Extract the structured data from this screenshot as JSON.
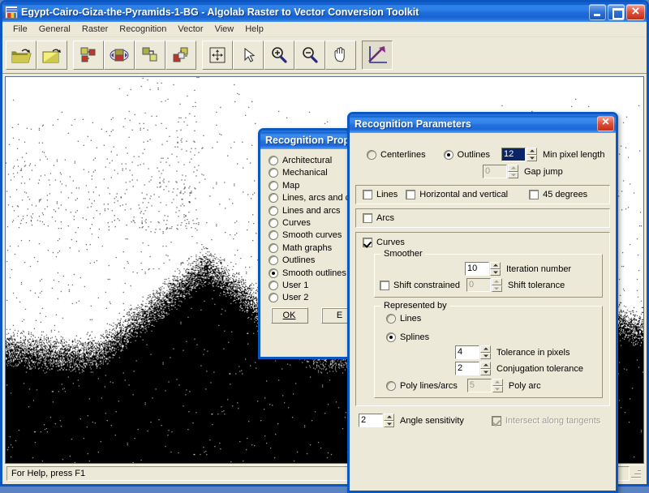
{
  "window": {
    "title": "Egypt-Cairo-Giza-the-Pyramids-1-BG - Algolab Raster to Vector Conversion Toolkit",
    "icon": "app-icon",
    "controls": {
      "minimize": "minimize-button",
      "maximize": "maximize-button",
      "close": "close-button"
    }
  },
  "menu": {
    "items": [
      {
        "label": "File"
      },
      {
        "label": "General"
      },
      {
        "label": "Raster"
      },
      {
        "label": "Recognition"
      },
      {
        "label": "Vector"
      },
      {
        "label": "View"
      },
      {
        "label": "Help"
      }
    ]
  },
  "toolbar": {
    "groups": [
      {
        "buttons": [
          {
            "icon": "open-folder-icon",
            "state": "raised"
          },
          {
            "icon": "open-image-icon",
            "state": "raised"
          }
        ]
      },
      {
        "buttons": [
          {
            "icon": "color-reduce-icon",
            "state": "raised"
          },
          {
            "icon": "invert-colors-icon",
            "state": "raised"
          },
          {
            "icon": "color-swap-icon",
            "state": "raised"
          },
          {
            "icon": "color-layers-icon",
            "state": "raised"
          }
        ]
      },
      {
        "buttons": [
          {
            "icon": "fit-to-window-icon",
            "state": "raised"
          },
          {
            "icon": "select-arrow-icon",
            "state": "raised"
          },
          {
            "icon": "zoom-in-icon",
            "state": "raised"
          },
          {
            "icon": "zoom-out-icon",
            "state": "raised"
          },
          {
            "icon": "pan-hand-icon",
            "state": "raised"
          }
        ]
      },
      {
        "buttons": [
          {
            "icon": "vectorize-icon",
            "state": "pressed"
          }
        ]
      }
    ]
  },
  "canvas": {
    "name": "raster-image-canvas",
    "description": "Dithered black and white raster image of the Giza pyramids"
  },
  "statusbar": {
    "message": "For Help, press F1"
  },
  "properties_dialog": {
    "title": "Recognition Prop",
    "options": [
      {
        "label": "Architectural",
        "selected": false
      },
      {
        "label": "Mechanical",
        "selected": false
      },
      {
        "label": "Map",
        "selected": false
      },
      {
        "label": "Lines, arcs and c",
        "selected": false
      },
      {
        "label": "Lines and arcs",
        "selected": false
      },
      {
        "label": "Curves",
        "selected": false
      },
      {
        "label": "Smooth curves",
        "selected": false
      },
      {
        "label": "Math graphs",
        "selected": false
      },
      {
        "label": "Outlines",
        "selected": false
      },
      {
        "label": "Smooth outlines",
        "selected": true
      },
      {
        "label": "User 1",
        "selected": false
      },
      {
        "label": "User 2",
        "selected": false
      }
    ],
    "buttons": {
      "ok": "OK",
      "edit": "E"
    }
  },
  "parameters_dialog": {
    "title": "Recognition Parameters",
    "mode": {
      "centerlines": {
        "label": "Centerlines",
        "selected": false
      },
      "outlines": {
        "label": "Outlines",
        "selected": true
      }
    },
    "min_pixel_length": {
      "label": "Min pixel length",
      "value": "12",
      "selected": true,
      "disabled": false
    },
    "gap_jump": {
      "label": "Gap jump",
      "value": "0",
      "disabled": true
    },
    "lines_group": [
      {
        "label": "Lines",
        "checked": false,
        "disabled": false
      },
      {
        "label": "Horizontal and vertical",
        "checked": false,
        "disabled": false
      },
      {
        "label": "45 degrees",
        "checked": false,
        "disabled": false
      }
    ],
    "arcs": {
      "label": "Arcs",
      "checked": false,
      "disabled": false
    },
    "curves": {
      "label": "Curves",
      "checked": true,
      "disabled": false
    },
    "smoother": {
      "legend": "Smoother",
      "iteration_number": {
        "label": "Iteration number",
        "value": "10",
        "disabled": false
      },
      "shift_constrained": {
        "label": "Shift constrained",
        "checked": false,
        "disabled": false
      },
      "shift_tolerance": {
        "label": "Shift tolerance",
        "value": "0",
        "disabled": true
      }
    },
    "represented_by": {
      "legend": "Represented by",
      "lines": {
        "label": "Lines",
        "selected": false
      },
      "splines": {
        "label": "Splines",
        "selected": true
      },
      "poly_lines_arcs": {
        "label": "Poly lines/arcs",
        "selected": false
      },
      "tolerance_in_pixels": {
        "label": "Tolerance in pixels",
        "value": "4",
        "disabled": false
      },
      "conjugation_tolerance": {
        "label": "Conjugation tolerance",
        "value": "2",
        "disabled": false
      },
      "poly_arc": {
        "label": "Poly arc",
        "value": "5",
        "disabled": true
      }
    },
    "angle_sensitivity": {
      "label": "Angle sensitivity",
      "value": "2",
      "disabled": false
    },
    "intersect_along_tangents": {
      "label": "Intersect along tangents",
      "checked": true,
      "disabled": true
    }
  },
  "colors": {
    "titlebar_blue": "#1e6ddb",
    "dialog_face": "#ece9d8",
    "desktop": "#5b83c4",
    "selection": "#0a246a",
    "close_red": "#c22f18"
  }
}
